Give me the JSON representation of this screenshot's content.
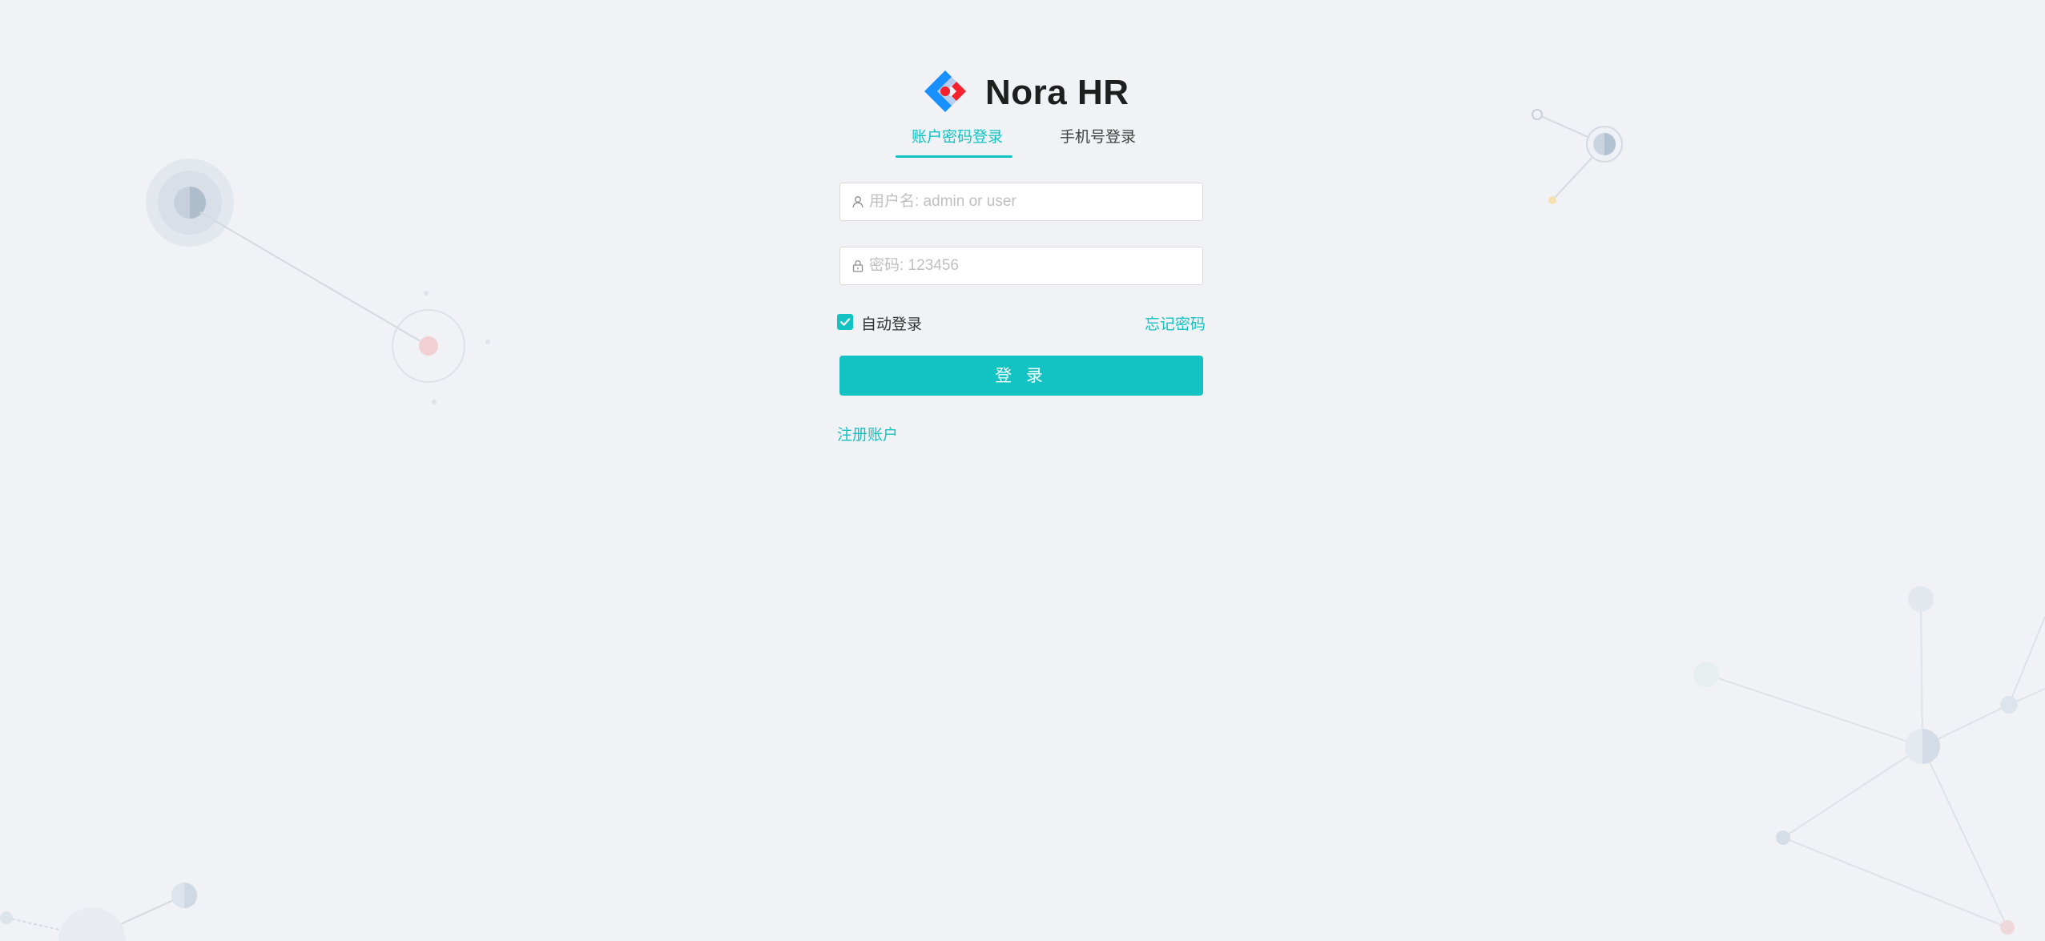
{
  "app": {
    "title": "Nora HR"
  },
  "tabs": [
    {
      "label": "账户密码登录",
      "active": true
    },
    {
      "label": "手机号登录",
      "active": false
    }
  ],
  "form": {
    "username": {
      "value": "",
      "placeholder": "用户名: admin or user"
    },
    "password": {
      "value": "",
      "placeholder": "密码: 123456"
    },
    "auto_login": {
      "label": "自动登录",
      "checked": true
    },
    "forgot_label": "忘记密码",
    "submit_label": "登 录",
    "register_label": "注册账户"
  },
  "colors": {
    "accent": "#13c2c2",
    "background": "#f0f2f5"
  },
  "icons": {
    "logo": "diamond-logo-icon",
    "username": "user-icon",
    "password": "lock-icon",
    "checkbox": "check-icon"
  }
}
